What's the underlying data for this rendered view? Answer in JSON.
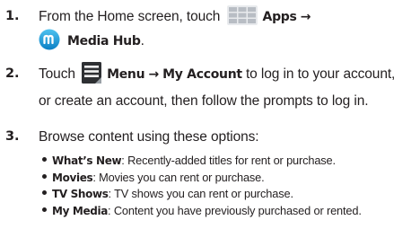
{
  "steps": [
    {
      "number": "1.",
      "part1": "From the Home screen, touch",
      "apps_label": "Apps",
      "arrow": "→",
      "media_hub_label": "Media Hub",
      "period": ".",
      "apps_icon": "apps-grid-icon",
      "media_hub_icon": "media-hub-icon"
    },
    {
      "number": "2.",
      "part1": "Touch",
      "menu_label": "Menu",
      "arrow": "→",
      "my_account_label": "My Account",
      "part2": "to log in to your account,",
      "line2": "or create an account, then follow the prompts to log in.",
      "menu_icon": "menu-icon"
    },
    {
      "number": "3.",
      "text": "Browse content using these options:"
    }
  ],
  "options": [
    {
      "term": "What’s New",
      "desc": ": Recently-added titles for rent or purchase."
    },
    {
      "term": "Movies",
      "desc": ": Movies you can rent or purchase."
    },
    {
      "term": "TV Shows",
      "desc": ": TV shows you can rent or purchase."
    },
    {
      "term": "My Media",
      "desc": ": Content you have previously purchased or rented."
    }
  ],
  "colors": {
    "text": "#231f20",
    "media_hub_blue": "#1a9bd7"
  }
}
